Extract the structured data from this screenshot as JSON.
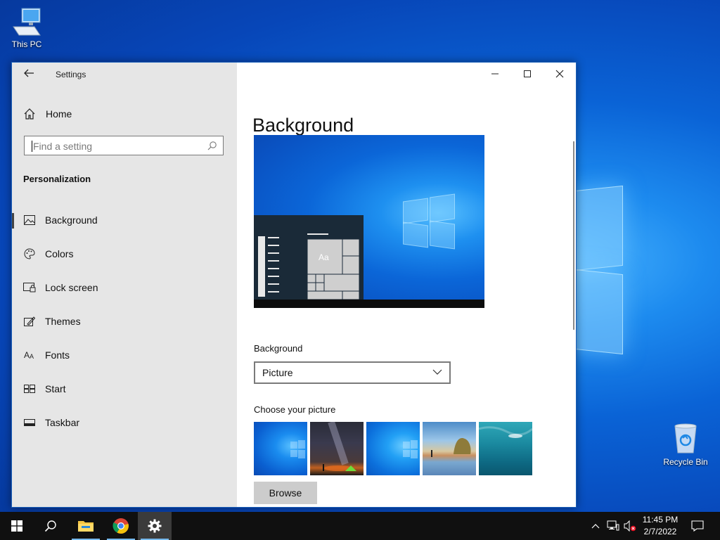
{
  "desktop": {
    "icons": [
      {
        "label": "This PC",
        "icon": "computer-icon"
      },
      {
        "label": "Recycle Bin",
        "icon": "recycle-bin-icon"
      }
    ]
  },
  "window": {
    "title": "Settings",
    "controls": {
      "minimize": "minimize-icon",
      "maximize": "maximize-icon",
      "close": "close-icon"
    }
  },
  "sidebar": {
    "home_label": "Home",
    "search_placeholder": "Find a setting",
    "section_title": "Personalization",
    "items": [
      {
        "label": "Background",
        "icon": "image-icon",
        "active": true
      },
      {
        "label": "Colors",
        "icon": "palette-icon",
        "active": false
      },
      {
        "label": "Lock screen",
        "icon": "lock-screen-icon",
        "active": false
      },
      {
        "label": "Themes",
        "icon": "themes-icon",
        "active": false
      },
      {
        "label": "Fonts",
        "icon": "fonts-icon",
        "active": false
      },
      {
        "label": "Start",
        "icon": "start-icon",
        "active": false
      },
      {
        "label": "Taskbar",
        "icon": "taskbar-icon",
        "active": false
      }
    ]
  },
  "main": {
    "title": "Background",
    "preview_tile_text": "Aa",
    "background_label": "Background",
    "background_value": "Picture",
    "choose_label": "Choose your picture",
    "browse_label": "Browse"
  },
  "taskbar": {
    "apps": [
      "start-icon",
      "search-icon",
      "file-explorer-icon",
      "chrome-icon",
      "settings-gear-icon"
    ],
    "active_app": "settings-gear-icon",
    "time": "11:45 PM",
    "date": "2/7/2022"
  }
}
